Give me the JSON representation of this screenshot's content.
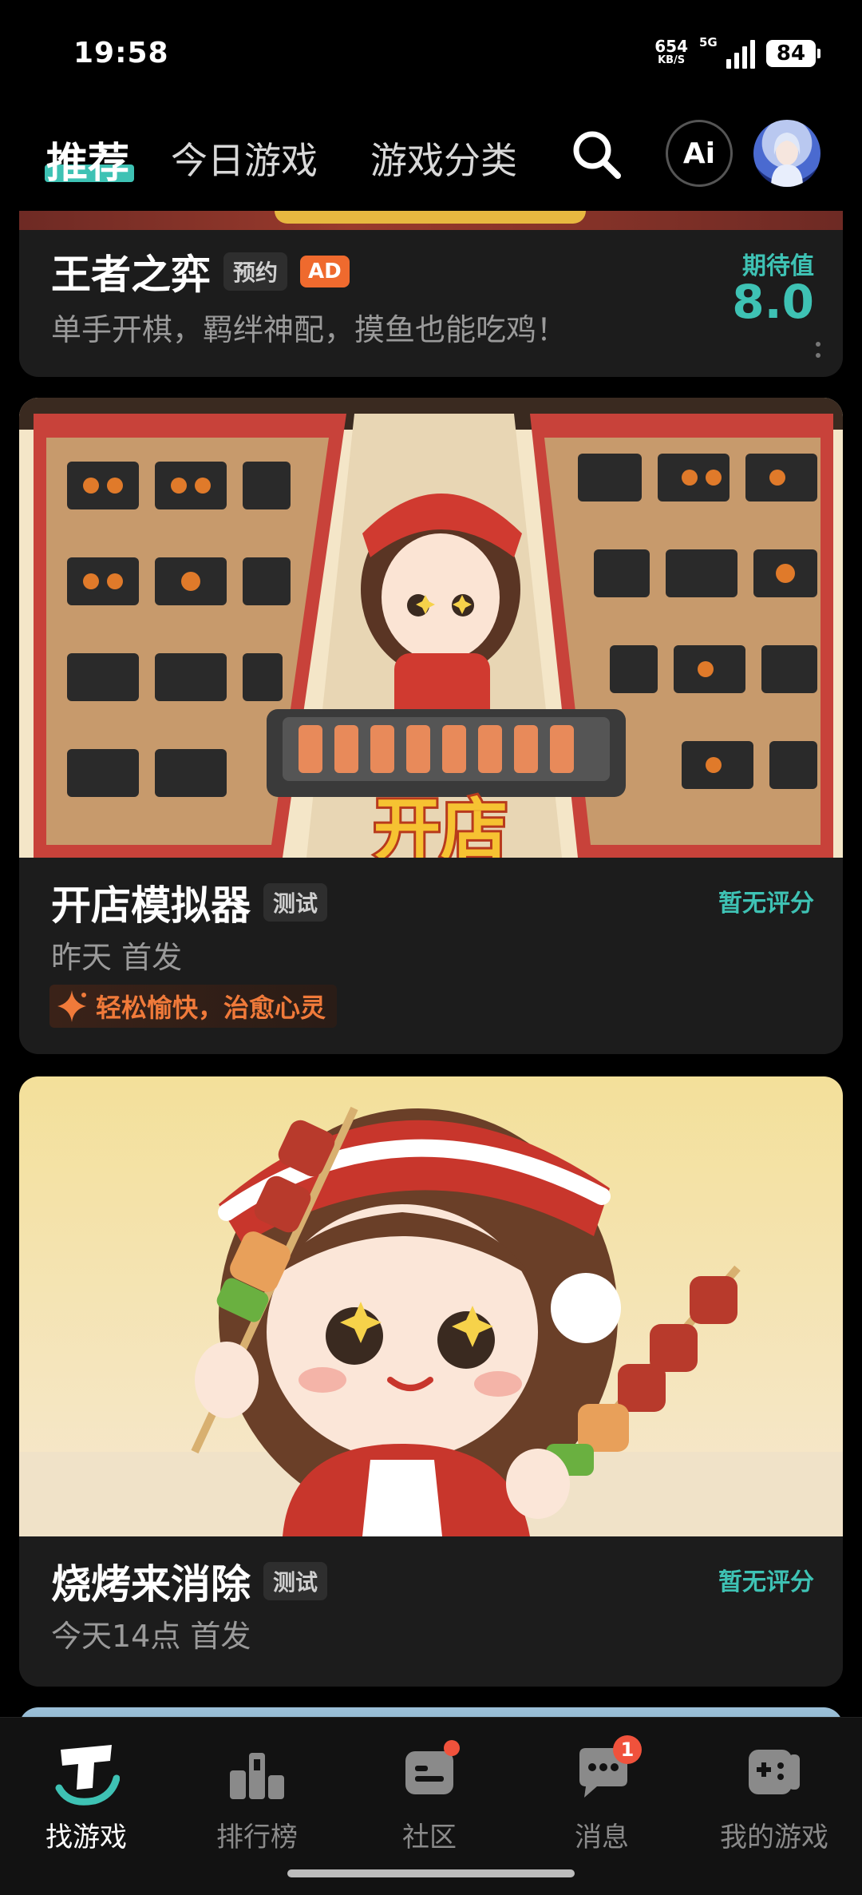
{
  "status_bar": {
    "time": "19:58",
    "net_speed": "654",
    "net_unit": "KB/S",
    "network": "5G",
    "battery": "84"
  },
  "top_nav": {
    "tabs": [
      {
        "label": "推荐",
        "active": true
      },
      {
        "label": "今日游戏",
        "active": false
      },
      {
        "label": "游戏分类",
        "active": false
      }
    ],
    "ai_label": "Ai"
  },
  "cards": [
    {
      "title": "王者之弈",
      "tag": "预约",
      "ad": "AD",
      "subtitle": "单手开棋，羁绊神配，摸鱼也能吃鸡！",
      "rating_label": "期待值",
      "rating_value": "8.0"
    },
    {
      "title": "开店模拟器",
      "tag": "测试",
      "subtitle": "昨天 首发",
      "rating_label": "暂无评分",
      "highlight": "轻松愉快，治愈心灵",
      "banner_text": "开店"
    },
    {
      "title": "烧烤来消除",
      "tag": "测试",
      "subtitle": "今天14点 首发",
      "rating_label": "暂无评分"
    }
  ],
  "bottom_nav": {
    "items": [
      {
        "label": "找游戏",
        "icon": "find-game-icon",
        "active": true
      },
      {
        "label": "排行榜",
        "icon": "leaderboard-icon",
        "active": false
      },
      {
        "label": "社区",
        "icon": "community-icon",
        "active": false,
        "dot": true
      },
      {
        "label": "消息",
        "icon": "message-icon",
        "active": false,
        "badge": "1"
      },
      {
        "label": "我的游戏",
        "icon": "my-games-icon",
        "active": false
      }
    ]
  },
  "colors": {
    "accent": "#3ec2b4",
    "ad_badge": "#ef6a2e",
    "highlight": "#f07a3a",
    "badge": "#f0523c"
  }
}
